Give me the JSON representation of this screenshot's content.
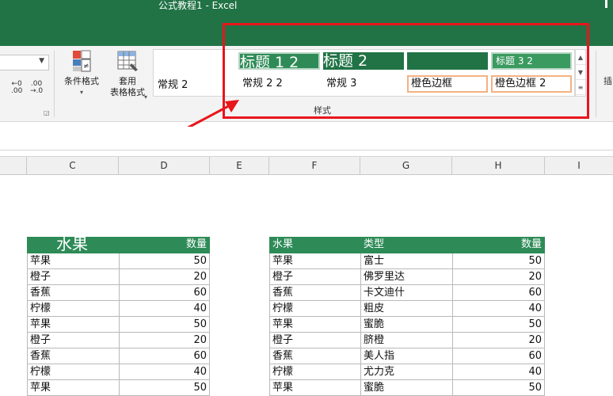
{
  "window": {
    "title": "公式教程1  -  Excel"
  },
  "ribbon": {
    "decimal_increase": [
      "←0",
      ".00"
    ],
    "decimal_decrease": [
      ".00",
      "→.0"
    ],
    "conditional_format": {
      "label": "条件格式"
    },
    "format_as_table": {
      "label_line1": "套用",
      "label_line2": "表格格式"
    },
    "styles_gallery": {
      "items": [
        {
          "label": "常规 2"
        },
        {
          "label": "标题 1 2"
        },
        {
          "label": "标题 2"
        },
        {
          "label": ""
        },
        {
          "label": "标题 3 2"
        },
        {
          "label": "常规 2 2"
        },
        {
          "label": "常规 3"
        },
        {
          "label": "橙色边框"
        },
        {
          "label": "橙色边框 2"
        }
      ]
    },
    "group_label": "样式",
    "right_cutoff": "插"
  },
  "columns": [
    "C",
    "D",
    "E",
    "F",
    "G",
    "H",
    "I"
  ],
  "table1": {
    "headers": [
      "水果",
      "数量"
    ],
    "rows": [
      [
        "苹果",
        "50"
      ],
      [
        "橙子",
        "20"
      ],
      [
        "香蕉",
        "60"
      ],
      [
        "柠檬",
        "40"
      ],
      [
        "苹果",
        "50"
      ],
      [
        "橙子",
        "20"
      ],
      [
        "香蕉",
        "60"
      ],
      [
        "柠檬",
        "40"
      ],
      [
        "苹果",
        "50"
      ]
    ]
  },
  "table2": {
    "headers": [
      "水果",
      "类型",
      "数量"
    ],
    "rows": [
      [
        "苹果",
        "富士",
        "50"
      ],
      [
        "橙子",
        "佛罗里达",
        "20"
      ],
      [
        "香蕉",
        "卡文迪什",
        "60"
      ],
      [
        "柠檬",
        "粗皮",
        "40"
      ],
      [
        "苹果",
        "蜜脆",
        "50"
      ],
      [
        "橙子",
        "脐橙",
        "20"
      ],
      [
        "香蕉",
        "美人指",
        "60"
      ],
      [
        "柠檬",
        "尤力克",
        "40"
      ],
      [
        "苹果",
        "蜜脆",
        "50"
      ]
    ]
  },
  "colors": {
    "excel_green": "#217346",
    "table_header": "#2e8b57",
    "highlight_red": "#e8151b",
    "orange_border": "#f4b183"
  }
}
